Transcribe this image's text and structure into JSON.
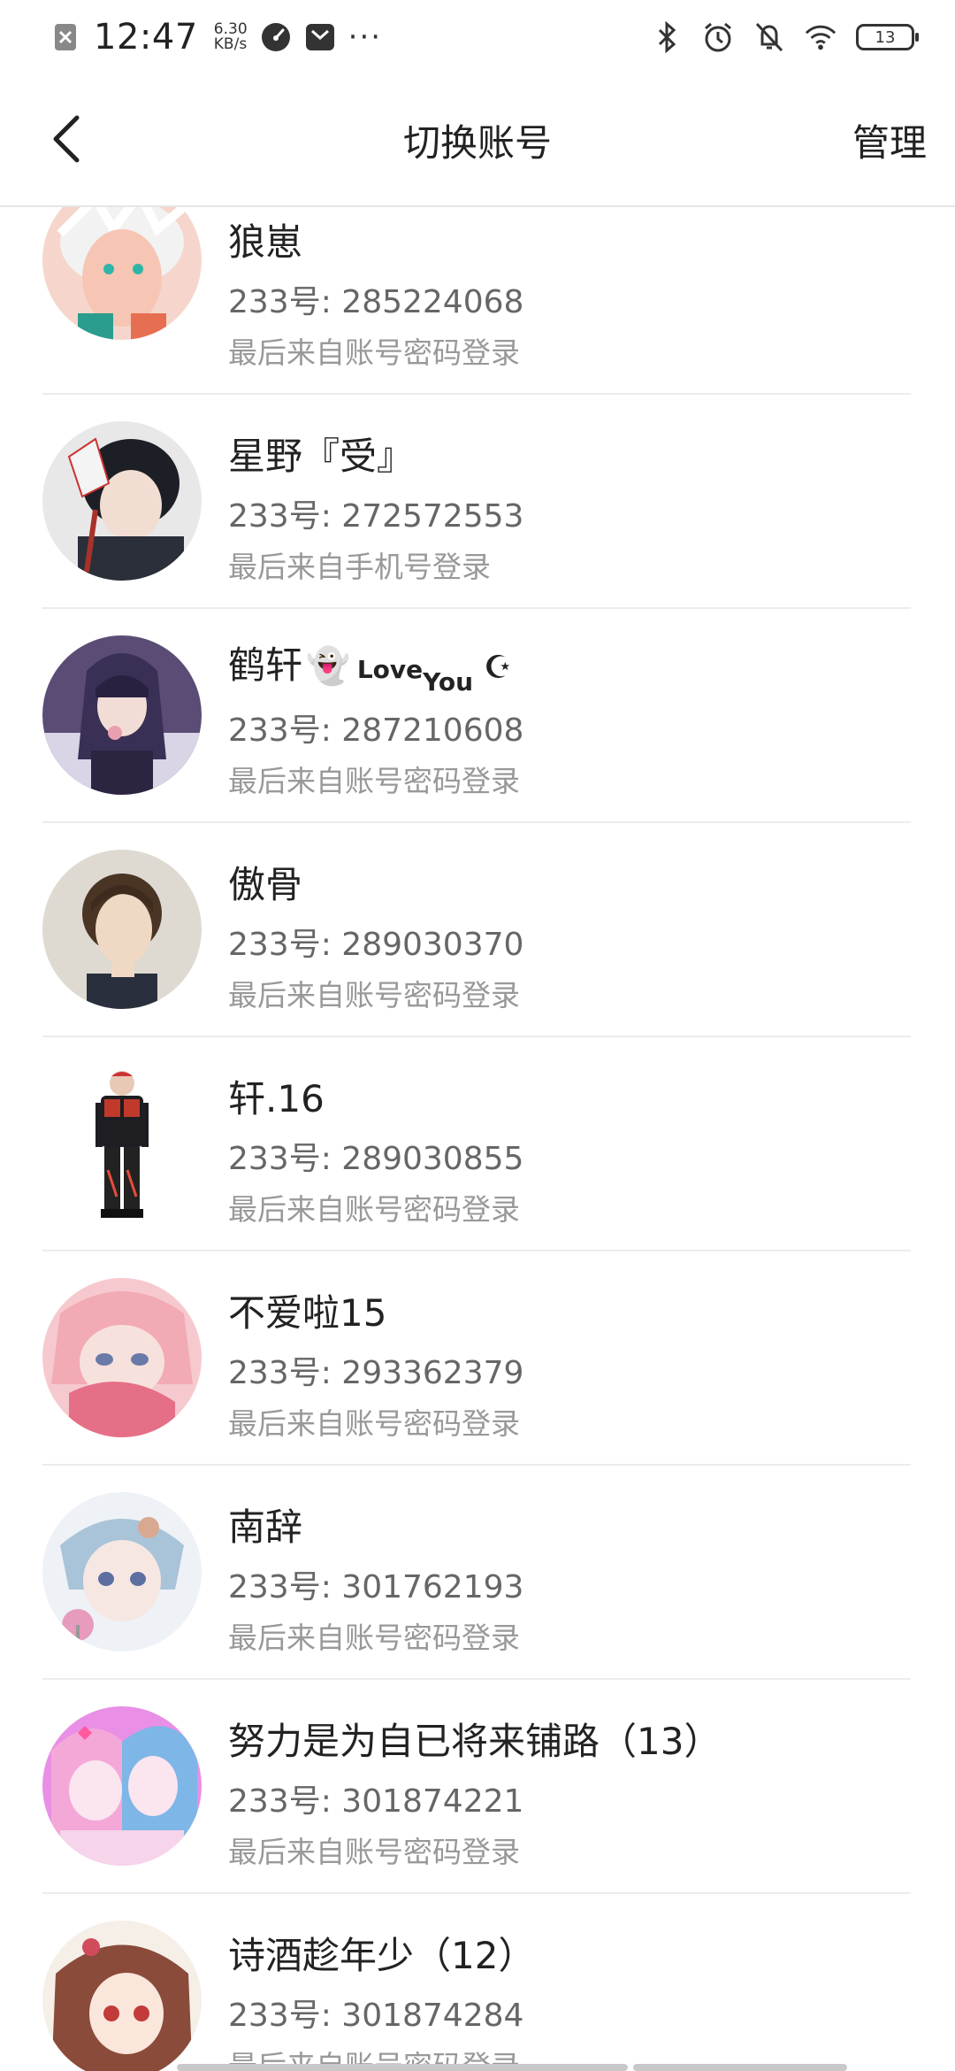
{
  "status": {
    "time": "12:47",
    "net_speed_value": "6.30",
    "net_speed_unit": "KB/s",
    "dots": "···",
    "battery": "13"
  },
  "nav": {
    "title": "切换账号",
    "manage": "管理"
  },
  "accounts": [
    {
      "name": "狼崽",
      "uid": "233号: 285224068",
      "login": "最后来自账号密码登录",
      "avatar_color": "#f3c7b9"
    },
    {
      "name": "星野『受』",
      "uid": "233号: 272572553",
      "login": "最后来自手机号登录",
      "avatar_color": "#3b3f4a"
    },
    {
      "name": "鹤轩",
      "emoji": "👻",
      "love": "Love",
      "you": "You",
      "moon": "☪",
      "uid": "233号: 287210608",
      "login": "最后来自账号密码登录",
      "avatar_color": "#4b3d66"
    },
    {
      "name": "傲骨",
      "uid": "233号: 289030370",
      "login": "最后来自账号密码登录",
      "avatar_color": "#d9d3c8"
    },
    {
      "name": "轩.16",
      "uid": "233号: 289030855",
      "login": "最后来自账号密码登录",
      "avatar_color": "#ffffff"
    },
    {
      "name": "不爱啦15",
      "uid": "233号: 293362379",
      "login": "最后来自账号密码登录",
      "avatar_color": "#f2b7bf"
    },
    {
      "name": "南辞",
      "uid": "233号: 301762193",
      "login": "最后来自账号密码登录",
      "avatar_color": "#c9d9e6"
    },
    {
      "name": "努力是为自已将来铺路（13）",
      "uid": "233号: 301874221",
      "login": "最后来自账号密码登录",
      "avatar_color": "#e88be0"
    },
    {
      "name": "诗酒趁年少（12）",
      "uid": "233号: 301874284",
      "login": "最后来自账号密码登录",
      "avatar_color": "#9b5a4a"
    }
  ]
}
